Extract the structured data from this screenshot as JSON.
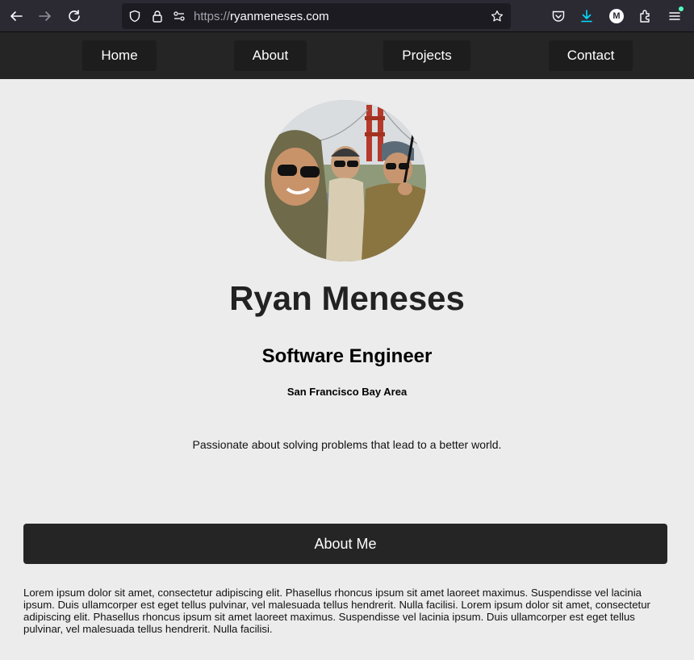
{
  "browser": {
    "url_scheme": "https://",
    "url_host": "ryanmeneses.com",
    "profile_initial": "M",
    "accent_color": "#54ffbd"
  },
  "nav": {
    "items": [
      {
        "label": "Home"
      },
      {
        "label": "About"
      },
      {
        "label": "Projects"
      },
      {
        "label": "Contact"
      }
    ]
  },
  "profile": {
    "name": "Ryan Meneses",
    "title": "Software Engineer",
    "location": "San Francisco Bay Area",
    "tagline": "Passionate about solving problems that lead to a better world."
  },
  "about": {
    "heading": "About Me",
    "body": "Lorem ipsum dolor sit amet, consectetur adipiscing elit. Phasellus rhoncus ipsum sit amet laoreet maximus. Suspendisse vel lacinia ipsum. Duis ullamcorper est eget tellus pulvinar, vel malesuada tellus hendrerit. Nulla facilisi. Lorem ipsum dolor sit amet, consectetur adipiscing elit. Phasellus rhoncus ipsum sit amet laoreet maximus. Suspendisse vel lacinia ipsum. Duis ullamcorper est eget tellus pulvinar, vel malesuada tellus hendrerit. Nulla facilisi."
  },
  "colors": {
    "nav_bg": "#252525",
    "page_bg": "#ececec"
  }
}
